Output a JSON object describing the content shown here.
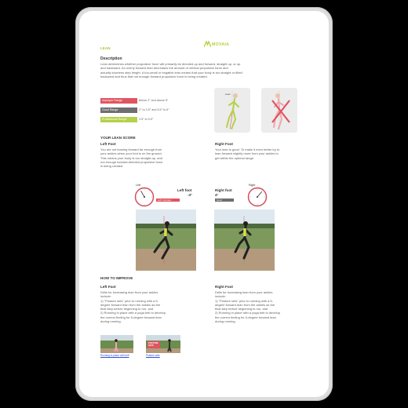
{
  "brand": {
    "name": "MOVAIA"
  },
  "page": {
    "title": "LEAN"
  },
  "description": {
    "heading": "Description",
    "lines": [
      "Lean determines whether propulsive force will primarily be directed up and forward, straight up, or up",
      "and backward. An overly forward lean decreases the amount of vertical propulsive force and",
      "actually shortens step length.  A too-small or negative lean means that your body is too straight or tilted",
      "backward and thus that not enough forward propulsive force is being created."
    ]
  },
  "ranges": [
    {
      "label": "Improper Range",
      "text": "Below 2° and above 6°",
      "color": "#e05561"
    },
    {
      "label": "Good Range",
      "text": "2° to 3.5° and 5.5° to 6°",
      "color": "#6f6f6f"
    },
    {
      "label": "Professional Range",
      "text": "3.5° to 5.5°",
      "color": "#b5d14a"
    }
  ],
  "score": {
    "heading": "YOUR LEAN SCORE",
    "left": {
      "title": "Left Foot",
      "lines": [
        "You are not leaning forward far enough from",
        "your ankles when your foot is on the ground.",
        "This means your body is too straight-up, and",
        "not enough forward-directed propulsive force",
        "is being created."
      ],
      "gauge_label": "Left",
      "foot_label": "Left foot",
      "value": "-3°",
      "value_deg": -3,
      "tag": "Left: Improper"
    },
    "right": {
      "title": "Right Foot",
      "lines": [
        "Your lean is good. To make it even better try to",
        "lean forward slightly more from your ankles to",
        "get within the optimal range."
      ],
      "gauge_label": "Right",
      "foot_label": "Right foot",
      "value": "4°",
      "value_deg": 4,
      "tag": "Good"
    }
  },
  "improve": {
    "heading": "HOW TO IMPROVE",
    "left": {
      "title": "Left Foot",
      "lines": [
        "Drills for increasing lean from your ankles",
        "include:",
        "1) \"Posture sets\" prior to running with a 5-",
        "degree forward lean from the ankles as the",
        "final step before beginning to run, and",
        "2) Running in place with a yoga belt to develop",
        "the correct feeling for 5-degree forward lean",
        "during running."
      ]
    },
    "right": {
      "title": "Right Foot",
      "lines": [
        "Drills for increasing lean from your ankles",
        "include:",
        "1) \"Posture sets\" prior to running with a 5-",
        "degree forward lean from the ankles as the",
        "final step before beginning to run, and",
        "2) Running in place with a yoga belt to develop",
        "the correct feeling for 5-degree forward lean",
        "during running."
      ]
    }
  },
  "videos": [
    {
      "link": "Running in-place with belt",
      "thumb_text": ""
    },
    {
      "link": "Posture sets",
      "thumb_text": "POSTURE SETS"
    }
  ]
}
